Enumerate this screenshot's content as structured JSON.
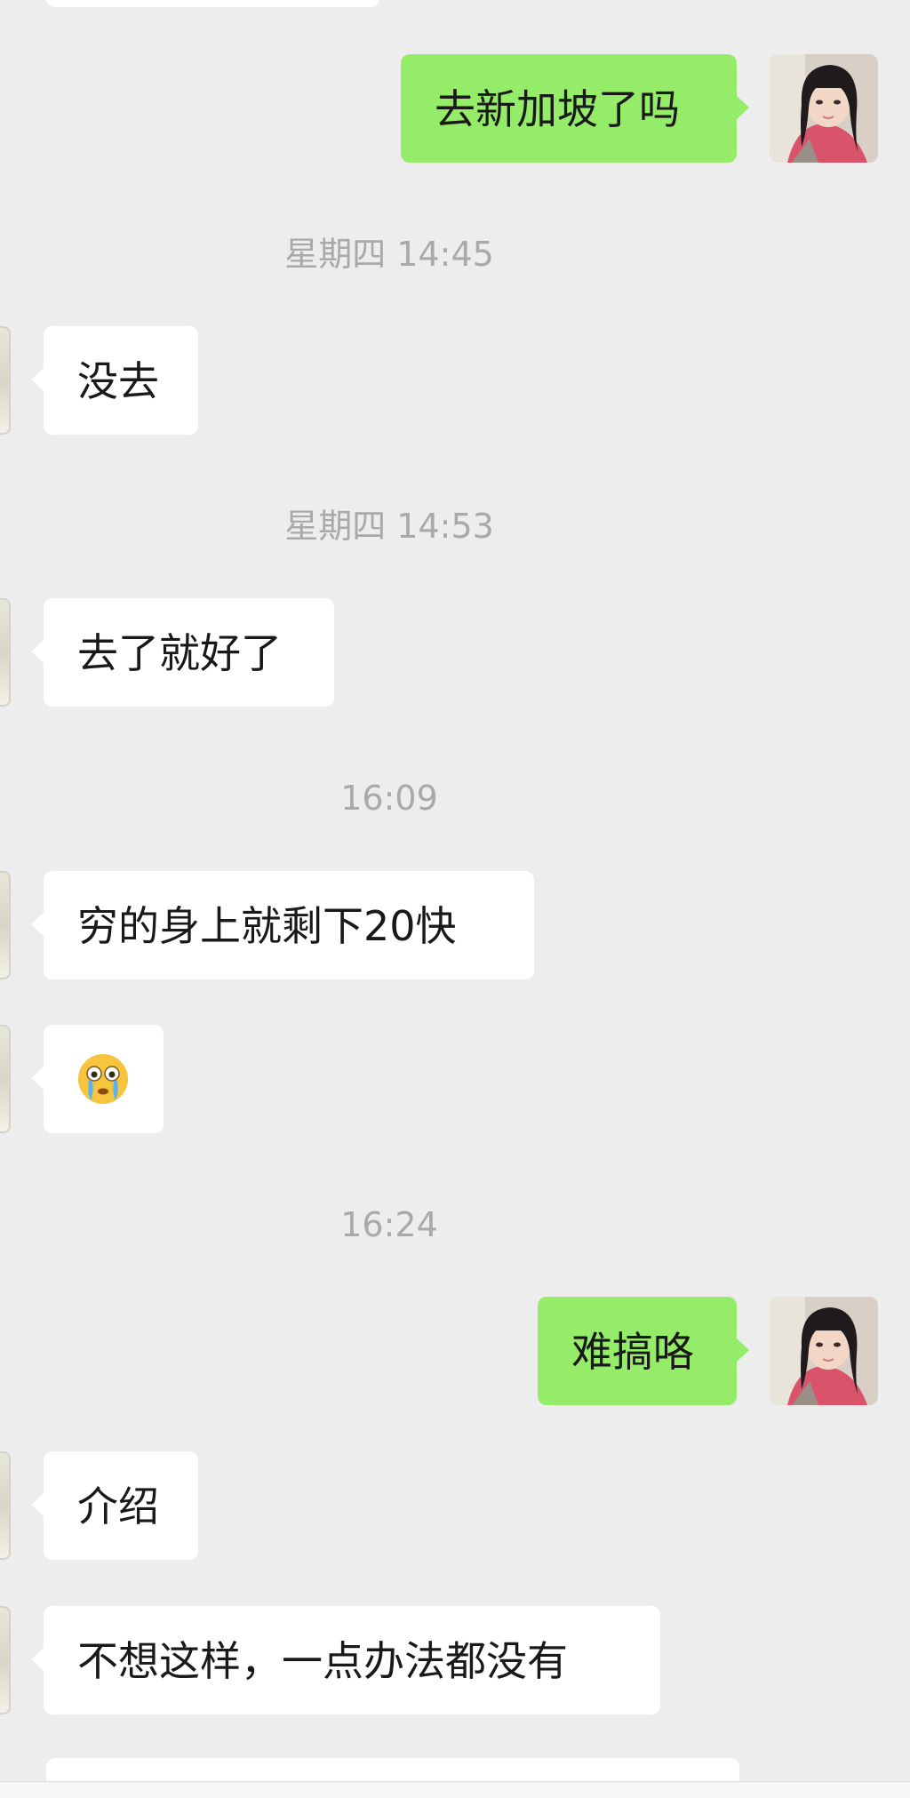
{
  "messages": [
    {
      "type": "text",
      "side": "right",
      "text": "去新加坡了吗"
    },
    {
      "type": "time",
      "text": "星期四 14:45"
    },
    {
      "type": "text",
      "side": "left",
      "text": "没去"
    },
    {
      "type": "time",
      "text": "星期四 14:53"
    },
    {
      "type": "text",
      "side": "left",
      "text": "去了就好了"
    },
    {
      "type": "time",
      "text": "16:09"
    },
    {
      "type": "text",
      "side": "left",
      "text": "穷的身上就剩下20快"
    },
    {
      "type": "emoji",
      "side": "left",
      "icon": "crying-face-emoji"
    },
    {
      "type": "time",
      "text": "16:24"
    },
    {
      "type": "text",
      "side": "right",
      "text": "难搞咯"
    },
    {
      "type": "text",
      "side": "left",
      "text": "介绍"
    },
    {
      "type": "text",
      "side": "left",
      "text": "不想这样，一点办法都没有"
    }
  ],
  "colors": {
    "background": "#ededed",
    "incoming_bubble": "#ffffff",
    "outgoing_bubble": "#95ec69",
    "timestamp_text": "#a9a9a9",
    "message_text": "#191919"
  }
}
